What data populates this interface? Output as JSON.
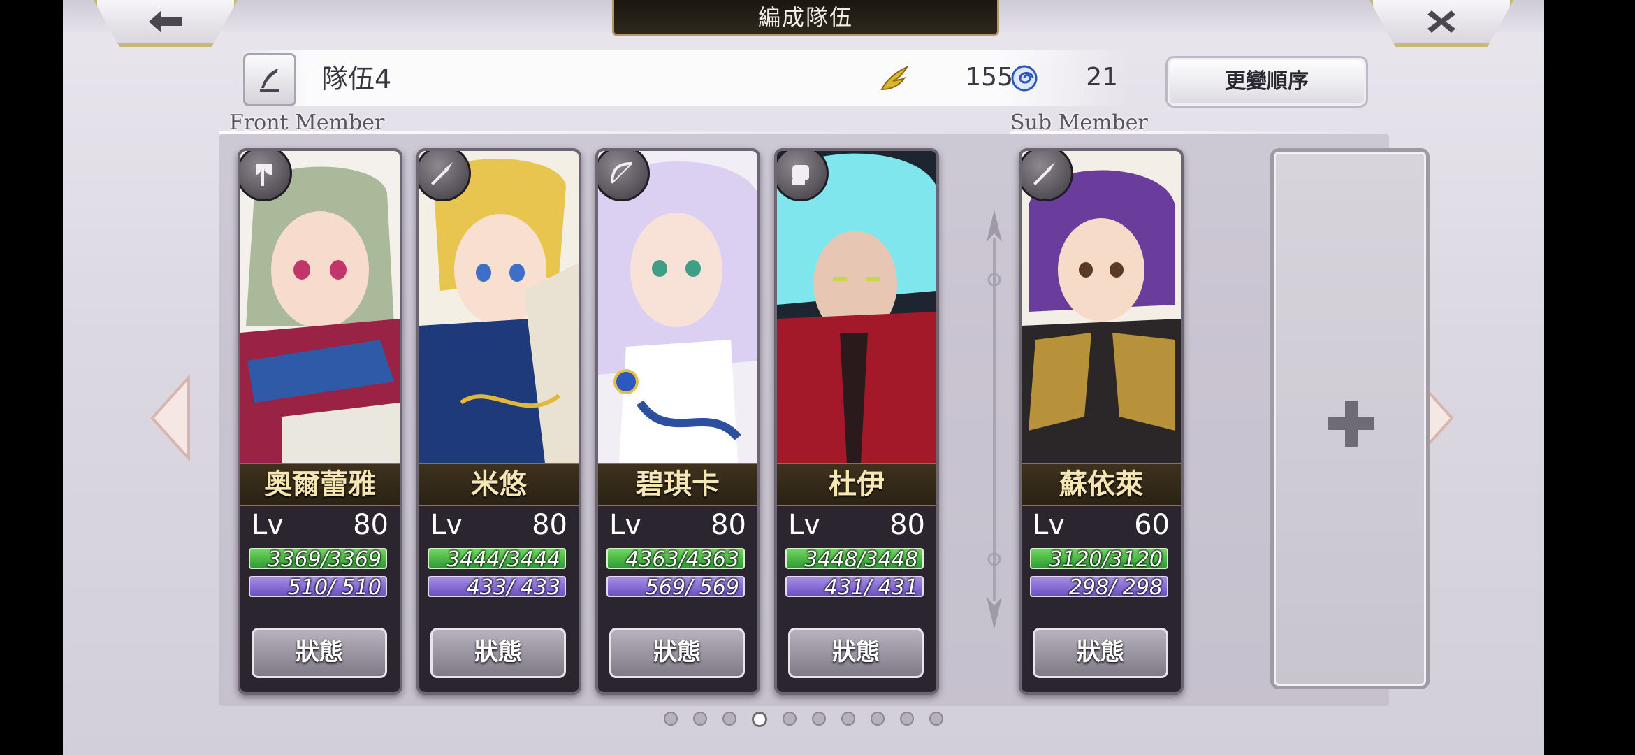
{
  "header": {
    "title": "編成隊伍"
  },
  "team": {
    "name": "隊伍4",
    "stat_wing": "155",
    "stat_spiral": "21",
    "order_button": "更變順序"
  },
  "sections": {
    "front": "Front Member",
    "sub": "Sub Member"
  },
  "front_members": [
    {
      "name": "奧爾蕾雅",
      "lv_label": "Lv",
      "lv": "80",
      "hp": "3369/3369",
      "mp": "510/ 510",
      "status_button": "狀態",
      "weapon_icon": "axe-icon"
    },
    {
      "name": "米悠",
      "lv_label": "Lv",
      "lv": "80",
      "hp": "3444/3444",
      "mp": "433/ 433",
      "status_button": "狀態",
      "weapon_icon": "spear-icon"
    },
    {
      "name": "碧琪卡",
      "lv_label": "Lv",
      "lv": "80",
      "hp": "4363/4363",
      "mp": "569/ 569",
      "status_button": "狀態",
      "weapon_icon": "bow-icon"
    },
    {
      "name": "杜伊",
      "lv_label": "Lv",
      "lv": "80",
      "hp": "3448/3448",
      "mp": "431/ 431",
      "status_button": "狀態",
      "weapon_icon": "fist-icon"
    }
  ],
  "sub_members": [
    {
      "name": "蘇依萊",
      "lv_label": "Lv",
      "lv": "60",
      "hp": "3120/3120",
      "mp": "298/ 298",
      "status_button": "狀態",
      "weapon_icon": "spear-icon"
    }
  ],
  "pager": {
    "total": 10,
    "active": 4
  },
  "colors": {
    "hp_bar": "#3fae3f",
    "mp_bar": "#7b5fd0",
    "name_plate": "#2a2216",
    "gold": "#c9b87a"
  }
}
